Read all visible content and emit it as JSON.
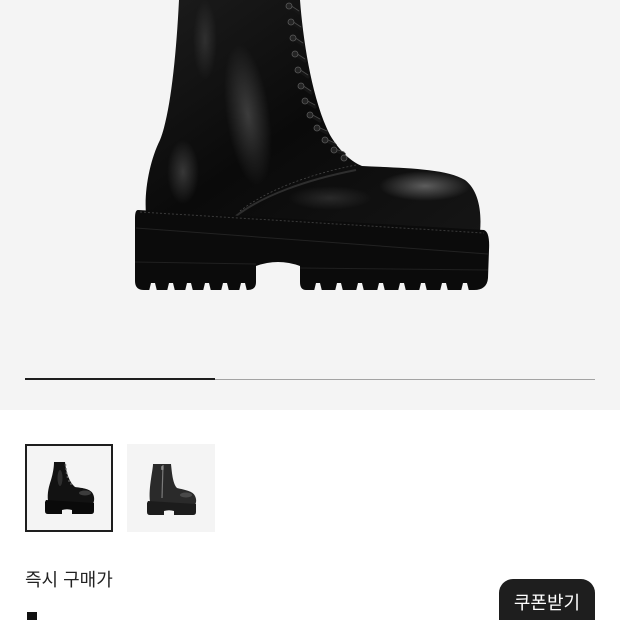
{
  "gallery": {
    "progress": 0.333,
    "thumbnails": [
      {
        "selected": true
      },
      {
        "selected": false
      }
    ]
  },
  "price": {
    "label": "즉시 구매가"
  },
  "coupon_button": {
    "label": "쿠폰받기"
  },
  "colors": {
    "accent": "#1e1e1e",
    "gallery_background": "#f4f4f4",
    "progress_track": "#a3a3a3"
  }
}
